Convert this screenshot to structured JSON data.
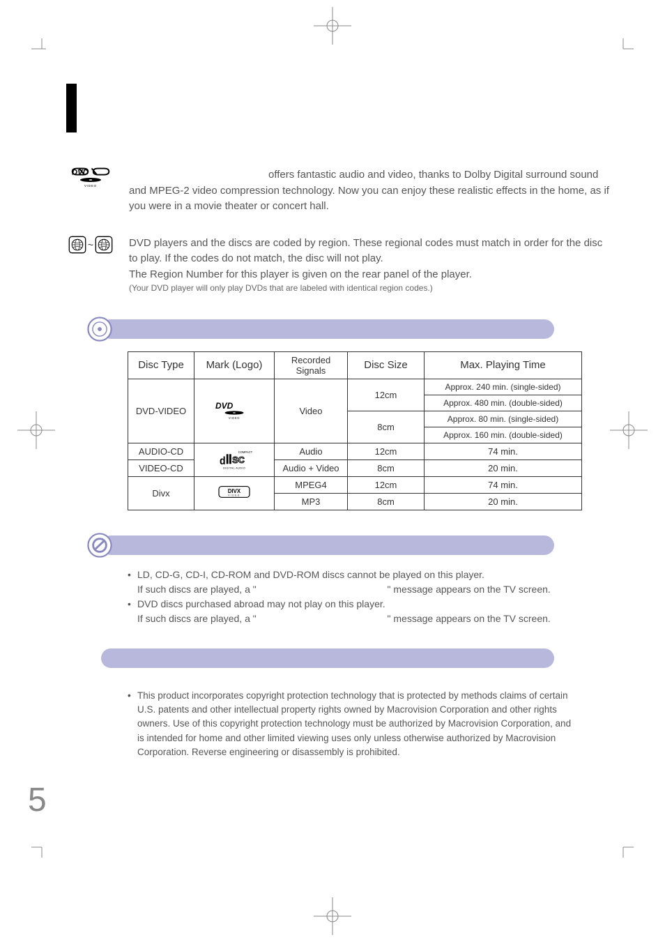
{
  "dvd_section": {
    "text": "offers fantastic audio and video, thanks to Dolby Digital surround sound and MPEG-2 video compression technology. Now you can enjoy these realistic effects in the home, as if you were in a movie theater or concert hall."
  },
  "region_section": {
    "line1": "DVD players and the discs are coded by region. These regional codes must match in order for the disc to play. If the codes do not match, the disc will not play.",
    "line2": "The Region Number for this player is given on the rear panel of the player.",
    "note": "(Your DVD player will only play DVDs that are labeled with identical region codes.)"
  },
  "table": {
    "headers": {
      "disc_type": "Disc Type",
      "mark_logo": "Mark (Logo)",
      "recorded_signals": "Recorded Signals",
      "disc_size": "Disc Size",
      "max_time": "Max. Playing Time"
    },
    "rows": {
      "dvd_video": {
        "type": "DVD-VIDEO",
        "signals": "Video",
        "size1": "12cm",
        "size2": "8cm",
        "time1": "Approx. 240 min. (single-sided)",
        "time2": "Approx. 480 min. (double-sided)",
        "time3": "Approx. 80 min. (single-sided)",
        "time4": "Approx. 160 min. (double-sided)"
      },
      "audio_cd": {
        "type": "AUDIO-CD",
        "signals": "Audio",
        "size": "12cm",
        "time": "74 min."
      },
      "video_cd": {
        "type": "VIDEO-CD",
        "signals": "Audio + Video",
        "size": "8cm",
        "time": "20 min."
      },
      "divx": {
        "type": "Divx",
        "signals1": "MPEG4",
        "signals2": "MP3",
        "size1": "12cm",
        "size2": "8cm",
        "time1": "74 min.",
        "time2": "20 min."
      }
    }
  },
  "not_play": {
    "item1a": "LD, CD-G, CD-I, CD-ROM and DVD-ROM discs cannot be played on this player.",
    "item1b": "If such discs are played, a \"",
    "item1c": "\" message appears on the TV screen.",
    "item2a": "DVD discs purchased abroad may not play on this player.",
    "item2b": "If such discs are played, a \"",
    "item2c": "\" message appears on the TV screen."
  },
  "copy": {
    "item2": "This product incorporates copyright protection technology that is protected by methods claims of certain U.S. patents and other intellectual property rights owned by Macrovision Corporation and other rights owners. Use of this copyright protection technology must be authorized by Macrovision Corporation, and is intended for home and other limited viewing uses only unless otherwise authorized by Macrovision Corporation. Reverse engineering or disassembly is prohibited."
  },
  "page_number": "5",
  "icons": {
    "tilde": "~"
  }
}
